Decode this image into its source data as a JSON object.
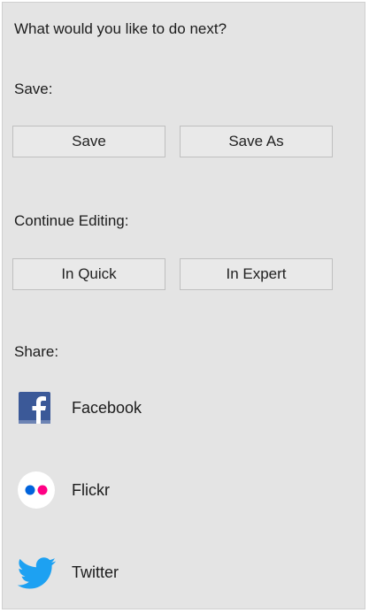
{
  "prompt": "What would you like to do next?",
  "save": {
    "heading": "Save:",
    "save_label": "Save",
    "save_as_label": "Save As"
  },
  "continue_editing": {
    "heading": "Continue Editing:",
    "quick_label": "In Quick",
    "expert_label": "In Expert"
  },
  "share": {
    "heading": "Share:",
    "items": [
      {
        "label": "Facebook",
        "icon": "facebook-icon",
        "color": "#3b5998"
      },
      {
        "label": "Flickr",
        "icon": "flickr-icon",
        "colors": [
          "#0063dc",
          "#ff0084"
        ]
      },
      {
        "label": "Twitter",
        "icon": "twitter-icon",
        "color": "#1da1f2"
      }
    ]
  }
}
